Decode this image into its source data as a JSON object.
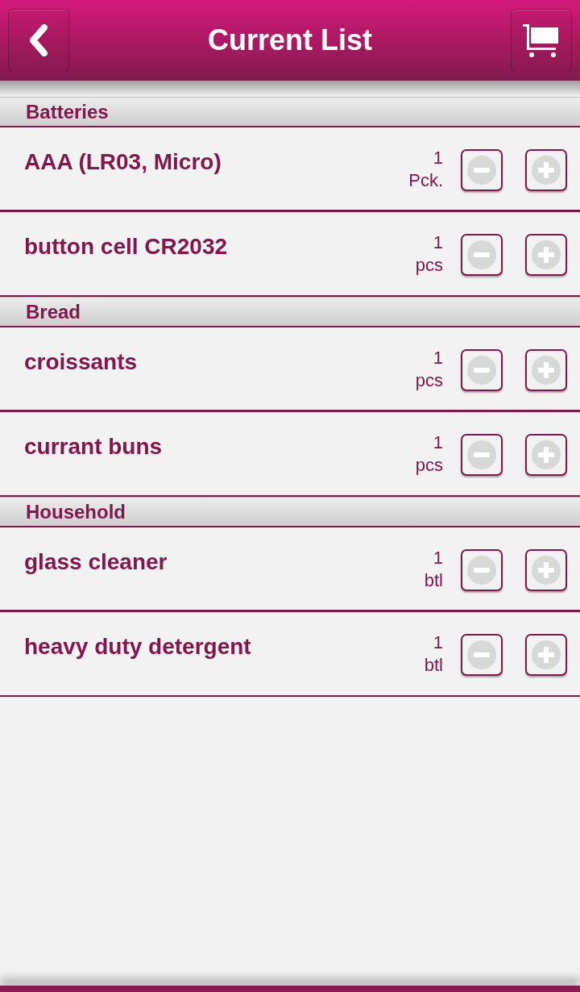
{
  "header": {
    "title": "Current List"
  },
  "sections": [
    {
      "name": "Batteries",
      "items": [
        {
          "name": "AAA (LR03, Micro)",
          "quantity": "1",
          "unit": "Pck."
        },
        {
          "name": "button cell CR2032",
          "quantity": "1",
          "unit": "pcs"
        }
      ]
    },
    {
      "name": "Bread",
      "items": [
        {
          "name": "croissants",
          "quantity": "1",
          "unit": "pcs"
        },
        {
          "name": "currant buns",
          "quantity": "1",
          "unit": "pcs"
        }
      ]
    },
    {
      "name": "Household",
      "items": [
        {
          "name": "glass cleaner",
          "quantity": "1",
          "unit": "btl"
        },
        {
          "name": "heavy duty detergent",
          "quantity": "1",
          "unit": "btl"
        }
      ]
    }
  ]
}
